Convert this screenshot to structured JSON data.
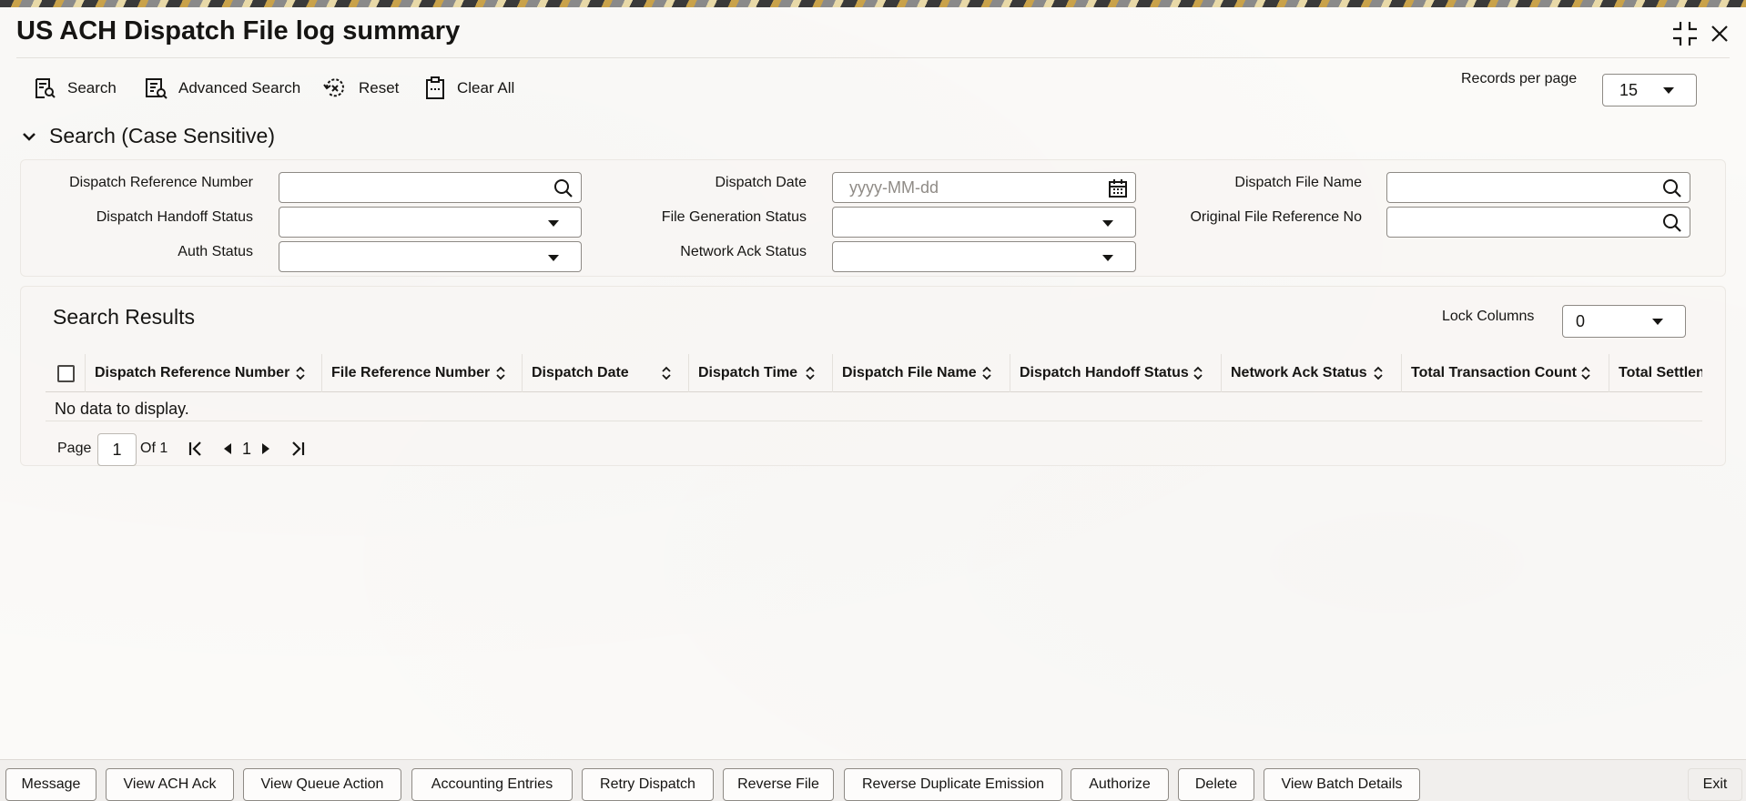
{
  "window": {
    "title": "US ACH Dispatch File log summary"
  },
  "toolbar": {
    "search_label": "Search",
    "advanced_search_label": "Advanced Search",
    "reset_label": "Reset",
    "clear_all_label": "Clear All",
    "records_per_page_label": "Records per page",
    "records_per_page_value": "15"
  },
  "search_section": {
    "title": "Search (Case Sensitive)",
    "fields": {
      "dispatch_reference_number": {
        "label": "Dispatch Reference Number",
        "value": ""
      },
      "dispatch_date": {
        "label": "Dispatch Date",
        "placeholder": "yyyy-MM-dd"
      },
      "dispatch_file_name": {
        "label": "Dispatch File Name",
        "value": ""
      },
      "dispatch_handoff_status": {
        "label": "Dispatch Handoff Status",
        "value": ""
      },
      "file_generation_status": {
        "label": "File Generation Status",
        "value": ""
      },
      "original_file_reference_no": {
        "label": "Original File Reference No",
        "value": ""
      },
      "auth_status": {
        "label": "Auth Status",
        "value": ""
      },
      "network_ack_status": {
        "label": "Network Ack Status",
        "value": ""
      }
    }
  },
  "results": {
    "title": "Search Results",
    "lock_columns_label": "Lock Columns",
    "lock_columns_value": "0",
    "columns": [
      "Dispatch Reference Number",
      "File Reference Number",
      "Dispatch Date",
      "Dispatch Time",
      "Dispatch File Name",
      "Dispatch Handoff Status",
      "Network Ack Status",
      "Total Transaction Count",
      "Total Settlen"
    ],
    "empty_message": "No data to display."
  },
  "pagination": {
    "page_label": "Page",
    "current_page": "1",
    "of_label": "Of 1",
    "page_number": "1"
  },
  "bottom_buttons": [
    "Message",
    "View ACH Ack",
    "View Queue Action",
    "Accounting Entries",
    "Retry Dispatch",
    "Reverse File",
    "Reverse Duplicate Emission",
    "Authorize",
    "Delete",
    "View Batch Details",
    "Exit"
  ],
  "colors": {
    "text": "#161513",
    "border": "#8e8a85",
    "background": "#fbfaf8",
    "bottom_bar": "#f1efed"
  }
}
